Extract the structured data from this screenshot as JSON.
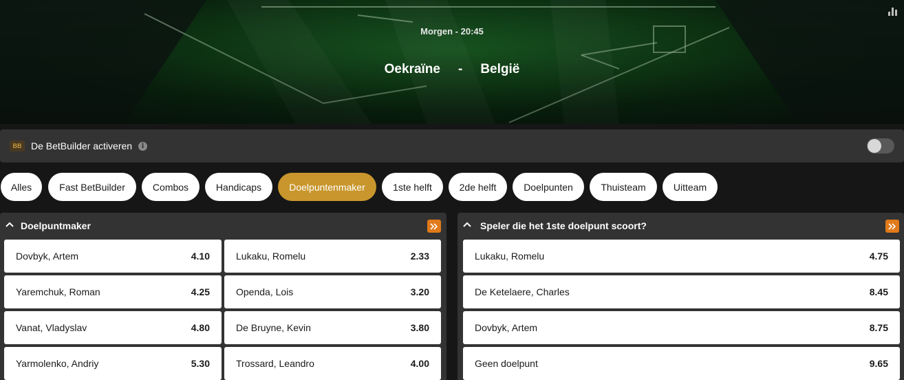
{
  "match": {
    "time": "Morgen - 20:45",
    "home": "Oekraïne",
    "separator": "-",
    "away": "België"
  },
  "betbuilder": {
    "badge": "BB",
    "label": "De BetBuilder activeren",
    "info_icon": "info-icon",
    "enabled": false
  },
  "tabs": [
    {
      "label": "Alles",
      "active": false
    },
    {
      "label": "Fast BetBuilder",
      "active": false
    },
    {
      "label": "Combos",
      "active": false
    },
    {
      "label": "Handicaps",
      "active": false
    },
    {
      "label": "Doelpuntenmaker",
      "active": true
    },
    {
      "label": "1ste helft",
      "active": false
    },
    {
      "label": "2de helft",
      "active": false
    },
    {
      "label": "Doelpunten",
      "active": false
    },
    {
      "label": "Thuisteam",
      "active": false
    },
    {
      "label": "Uitteam",
      "active": false
    }
  ],
  "markets": [
    {
      "title": "Doelpuntmaker",
      "columns": [
        [
          {
            "name": "Dovbyk, Artem",
            "odds": "4.10"
          },
          {
            "name": "Yaremchuk, Roman",
            "odds": "4.25"
          },
          {
            "name": "Vanat, Vladyslav",
            "odds": "4.80"
          },
          {
            "name": "Yarmolenko, Andriy",
            "odds": "5.30"
          }
        ],
        [
          {
            "name": "Lukaku, Romelu",
            "odds": "2.33"
          },
          {
            "name": "Openda, Lois",
            "odds": "3.20"
          },
          {
            "name": "De Bruyne, Kevin",
            "odds": "3.80"
          },
          {
            "name": "Trossard, Leandro",
            "odds": "4.00"
          }
        ]
      ]
    },
    {
      "title": "Speler die het 1ste doelpunt scoort?",
      "columns": [
        [
          {
            "name": "Lukaku, Romelu",
            "odds": "4.75"
          },
          {
            "name": "De Ketelaere, Charles",
            "odds": "8.45"
          },
          {
            "name": "Dovbyk, Artem",
            "odds": "8.75"
          },
          {
            "name": "Geen doelpunt",
            "odds": "9.65"
          }
        ]
      ]
    }
  ],
  "colors": {
    "accent_gold": "#c8962c",
    "expand_orange": "#e07a1a",
    "panel_bg": "#333333",
    "page_bg": "#161616"
  }
}
